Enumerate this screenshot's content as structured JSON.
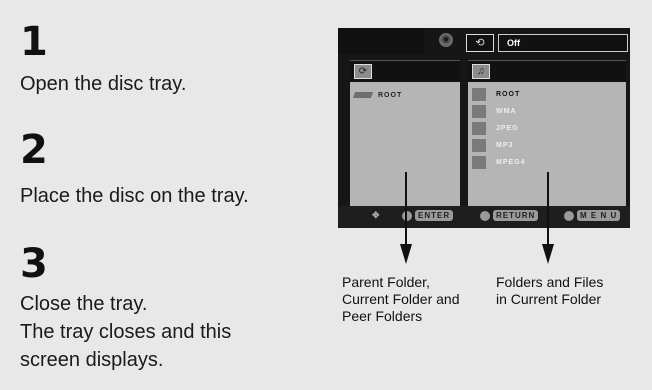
{
  "steps": [
    {
      "number": "1",
      "text_lines": [
        "Open the disc tray."
      ]
    },
    {
      "number": "2",
      "text_lines": [
        "Place the disc on the tray."
      ]
    },
    {
      "number": "3",
      "text_lines": [
        "Close the tray.",
        "The tray closes and this",
        "screen displays."
      ]
    }
  ],
  "screen": {
    "disc_icon": "disc-icon",
    "repeat_icon": "repeat-icon",
    "repeat_status": "Off",
    "left_pane": {
      "header_icon": "folder-tree-icon",
      "root_label": "ROOT"
    },
    "right_pane": {
      "header_icon": "file-list-icon",
      "items": [
        "ROOT",
        "WMA",
        "JPEG",
        "MP3",
        "MPEG4"
      ]
    },
    "controls": {
      "nav_icon": "direction-pad-icon",
      "enter_label": "ENTER",
      "return_label": "RETURN",
      "menu_label": "M E N U"
    }
  },
  "captions": {
    "left": [
      "Parent Folder,",
      "Current Folder and",
      "Peer Folders"
    ],
    "right": [
      "Folders and Files",
      "in Current Folder"
    ]
  },
  "colors": {
    "background": "#e8e8e8",
    "screen_dark": "#161616",
    "pane_gray": "#b5b5b5"
  }
}
